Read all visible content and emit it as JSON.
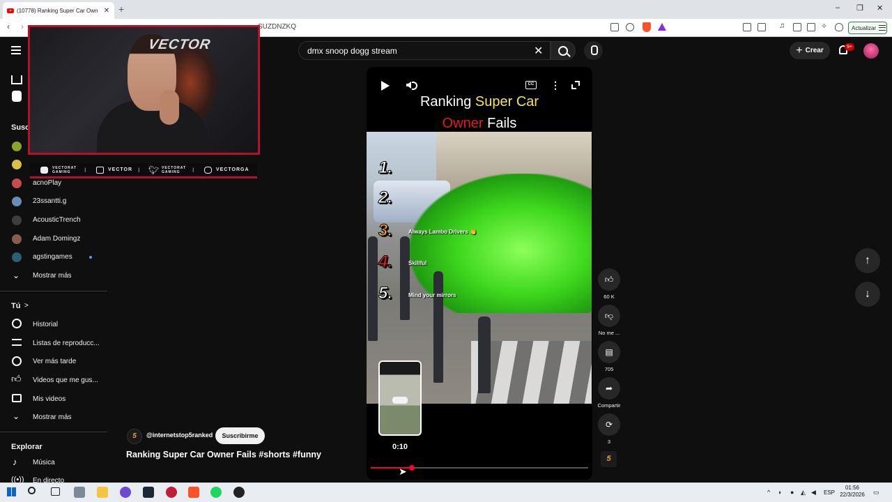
{
  "browser": {
    "tab_title": "(10778) Ranking Super Car Own",
    "new_tab": "+",
    "url": "SUZDNZKQ",
    "update_button": "Actualizar",
    "window_controls": [
      "–",
      "❐",
      "✕"
    ]
  },
  "header": {
    "search_value": "dmx snoop dogg stream",
    "clear": "✕",
    "create_label": "Crear",
    "notification_count": "9+"
  },
  "sidebar": {
    "subscriptions_heading": "Susc",
    "subscriptions": [
      {
        "label": "acnoPlay",
        "color": "#c94b4b"
      },
      {
        "label": "23ssantti.g",
        "color": "#6b8db5"
      },
      {
        "label": "AcousticTrench",
        "color": "#3d3d3d"
      },
      {
        "label": "Adam Domingz",
        "color": "#8b5a4a"
      },
      {
        "label": "agstingames",
        "color": "#2b5f73"
      }
    ],
    "show_more_1": "Mostrar más",
    "you_heading": "Tú",
    "you_chevron": ">",
    "you_items": [
      "Historial",
      "Listas de reproducc...",
      "Ver más tarde",
      "Videos que me gus...",
      "Mis videos"
    ],
    "show_more_2": "Mostrar más",
    "explore_heading": "Explorar",
    "explore_items": [
      "Música",
      "En directo"
    ]
  },
  "stream_overlay": {
    "logo_text": "VECTOR",
    "socials": [
      {
        "icon": "youtube-icon",
        "label": "VECTORAT GAMING"
      },
      {
        "icon": "twitch-icon",
        "label": "VECTOR"
      },
      {
        "icon": "twitter-icon",
        "label": "VECTORAT GAMING"
      },
      {
        "icon": "instagram-icon",
        "label": "VECTORGA"
      }
    ],
    "separator": "I"
  },
  "short": {
    "video_title_line1_white": "Ranking",
    "video_title_line1_yellow": "Super Car",
    "video_title_line2_red": "Owner",
    "video_title_line2_white": "Fails",
    "ranks": [
      "1.",
      "2.",
      "3.",
      "4.",
      "5."
    ],
    "captions": [
      "Always Lambo Drivers 👏",
      "Skillful",
      "Mind your mirrors"
    ],
    "timestamp": "0:10",
    "progress": 0.19,
    "cc_label": "CC",
    "channel_handle": "@internetstop5ranked",
    "channel_badge": "5",
    "subscribe_label": "Suscribirme",
    "title": "Ranking Super Car Owner Fails #shorts #funny",
    "actions": {
      "like_count": "60 K",
      "dislike_label": "No me ...",
      "comment_count": "705",
      "share_label": "Compartir",
      "remix_count": "3"
    }
  },
  "nav": {
    "up": "↑",
    "down": "↓"
  },
  "taskbar": {
    "lang": "ESP",
    "time": "01:56",
    "date": "22/3/2026"
  },
  "colors": {
    "accent_red": "#ff0033",
    "overlay_red": "#b3122c",
    "title_yellow": "#f5e64a"
  }
}
